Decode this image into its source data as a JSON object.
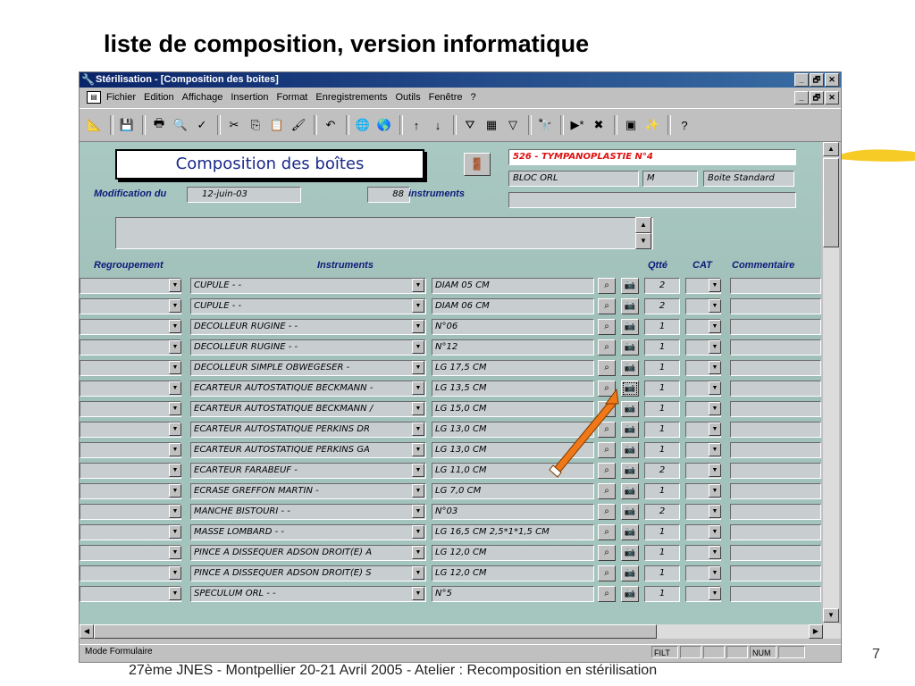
{
  "slide": {
    "title": "liste de composition, version informatique",
    "page_number": "7",
    "footer": "27ème JNES - Montpellier 20-21 Avril 2005 - Atelier : Recomposition en stérilisation"
  },
  "window": {
    "title": "Stérilisation - [Composition des boites]",
    "buttons": [
      "_",
      "🗗",
      "✕"
    ]
  },
  "menubar": {
    "items": [
      "Fichier",
      "Edition",
      "Affichage",
      "Insertion",
      "Format",
      "Enregistrements",
      "Outils",
      "Fenêtre",
      "?"
    ]
  },
  "form": {
    "title": "Composition des boîtes",
    "modification_label": "Modification du",
    "modification_date": "12-juin-03",
    "instrument_count": "88",
    "instruments_label": "instruments",
    "box_name": "526 - TYMPANOPLASTIE N°4",
    "bloc": "BLOC ORL",
    "size": "M",
    "box_type": "Boite Standard"
  },
  "columns": {
    "regroupement": "Regroupement",
    "instruments": "Instruments",
    "qtte": "Qtté",
    "cat": "CAT",
    "commentaire": "Commentaire"
  },
  "rows": [
    {
      "instrument": "CUPULE - -",
      "desc": "DIAM 05 CM",
      "qty": "2"
    },
    {
      "instrument": "CUPULE - -",
      "desc": "DIAM 06 CM",
      "qty": "2"
    },
    {
      "instrument": "DECOLLEUR RUGINE - -",
      "desc": "N°06",
      "qty": "1"
    },
    {
      "instrument": "DECOLLEUR RUGINE - -",
      "desc": "N°12",
      "qty": "1"
    },
    {
      "instrument": "DECOLLEUR SIMPLE OBWEGESER -",
      "desc": "LG 17,5 CM",
      "qty": "1"
    },
    {
      "instrument": "ECARTEUR AUTOSTATIQUE BECKMANN -",
      "desc": "LG 13,5 CM",
      "qty": "1"
    },
    {
      "instrument": "ECARTEUR AUTOSTATIQUE BECKMANN /",
      "desc": "LG 15,0 CM",
      "qty": "1"
    },
    {
      "instrument": "ECARTEUR AUTOSTATIQUE PERKINS DR",
      "desc": "LG 13,0 CM",
      "qty": "1"
    },
    {
      "instrument": "ECARTEUR AUTOSTATIQUE PERKINS GA",
      "desc": "LG 13,0 CM",
      "qty": "1"
    },
    {
      "instrument": "ECARTEUR FARABEUF -",
      "desc": "LG 11,0 CM",
      "qty": "2"
    },
    {
      "instrument": "ECRASE GREFFON MARTIN -",
      "desc": "LG 7,0 CM",
      "qty": "1"
    },
    {
      "instrument": "MANCHE BISTOURI - -",
      "desc": "N°03",
      "qty": "2"
    },
    {
      "instrument": "MASSE LOMBARD - -",
      "desc": "LG 16,5 CM     2,5*1*1,5 CM",
      "qty": "1"
    },
    {
      "instrument": "PINCE A DISSEQUER ADSON DROIT(E) A",
      "desc": "LG 12,0 CM",
      "qty": "1"
    },
    {
      "instrument": "PINCE A DISSEQUER ADSON DROIT(E) S",
      "desc": "LG 12,0 CM",
      "qty": "1"
    },
    {
      "instrument": "SPECULUM ORL - -",
      "desc": "N°5",
      "qty": "1"
    }
  ],
  "statusbar": {
    "mode": "Mode Formulaire",
    "filt": "FILT",
    "num": "NUM"
  },
  "icons": {
    "search": "magnifier-icon",
    "photo": "camera-icon",
    "annotation": "orange-arrow"
  },
  "colors": {
    "titlebar": "#0a246a",
    "form_bg": "#a9c8c2",
    "label": "#101a7a",
    "box_name": "#dd1111",
    "arrow": "#f07818"
  }
}
